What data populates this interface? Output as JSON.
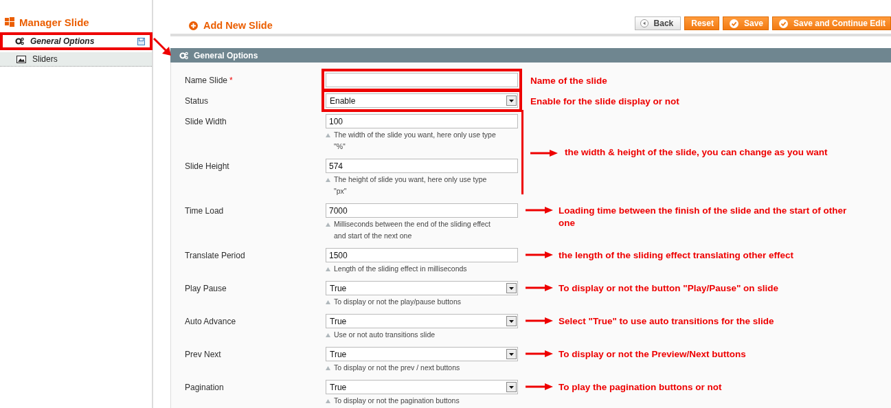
{
  "sidebar": {
    "title": "Manager Slide",
    "items": [
      {
        "label": "General Options",
        "kind": "options",
        "selected": true,
        "annotated": true
      },
      {
        "label": "Sliders",
        "kind": "images",
        "selected": false,
        "annotated": false
      }
    ]
  },
  "header": {
    "title": "Add New Slide",
    "buttons": [
      {
        "label": "Back",
        "kind": "back"
      },
      {
        "label": "Reset",
        "kind": "plain"
      },
      {
        "label": "Save",
        "kind": "check"
      },
      {
        "label": "Save and Continue Edit",
        "kind": "check"
      }
    ]
  },
  "section": {
    "title": "General Options"
  },
  "fields": [
    {
      "label": "Name Slide",
      "required_mark": "*",
      "kind": "text",
      "annotation": {
        "kind": "box",
        "text": "Name of the slide"
      }
    },
    {
      "label": "Status",
      "kind": "select",
      "value": "Enable",
      "annotation": {
        "kind": "box",
        "text": "Enable for the slide display or not"
      }
    },
    {
      "label": "Slide Width",
      "kind": "text",
      "value": "100",
      "note": "The width of the slide you want, here only use type \"%\"",
      "annotation": {
        "kind": "bracket",
        "text": "the width & height of the slide, you can change as you want"
      }
    },
    {
      "label": "Slide Height",
      "kind": "text",
      "value": "574",
      "note": "The height of slide you want, here only use type \"px\""
    },
    {
      "label": "Time Load",
      "kind": "text",
      "value": "7000",
      "note": "Milliseconds between the end of the sliding effect and start of the next one",
      "annotation": {
        "kind": "arrow",
        "text": "Loading time between the finish of the slide and the start of other one"
      }
    },
    {
      "label": "Translate Period",
      "kind": "text",
      "value": "1500",
      "note": "Length of the sliding effect in milliseconds",
      "annotation": {
        "kind": "arrow",
        "text": "the length of the sliding effect translating other effect"
      }
    },
    {
      "label": "Play Pause",
      "kind": "select",
      "value": "True",
      "note": "To display or not the play/pause buttons",
      "annotation": {
        "kind": "arrow",
        "text": "To display or not the button \"Play/Pause\" on slide"
      }
    },
    {
      "label": "Auto Advance",
      "kind": "select",
      "value": "True",
      "note": "Use or not auto transitions slide",
      "annotation": {
        "kind": "arrow",
        "text": "Select \"True\" to use auto transitions for the slide"
      }
    },
    {
      "label": "Prev Next",
      "kind": "select",
      "value": "True",
      "note": "To display or not the prev / next buttons",
      "annotation": {
        "kind": "arrow",
        "text": "To display or not the Preview/Next buttons"
      }
    },
    {
      "label": "Pagination",
      "kind": "select",
      "value": "True",
      "note": "To display or not the pagination buttons",
      "annotation": {
        "kind": "arrow",
        "text": "To play the pagination buttons or not"
      }
    }
  ]
}
